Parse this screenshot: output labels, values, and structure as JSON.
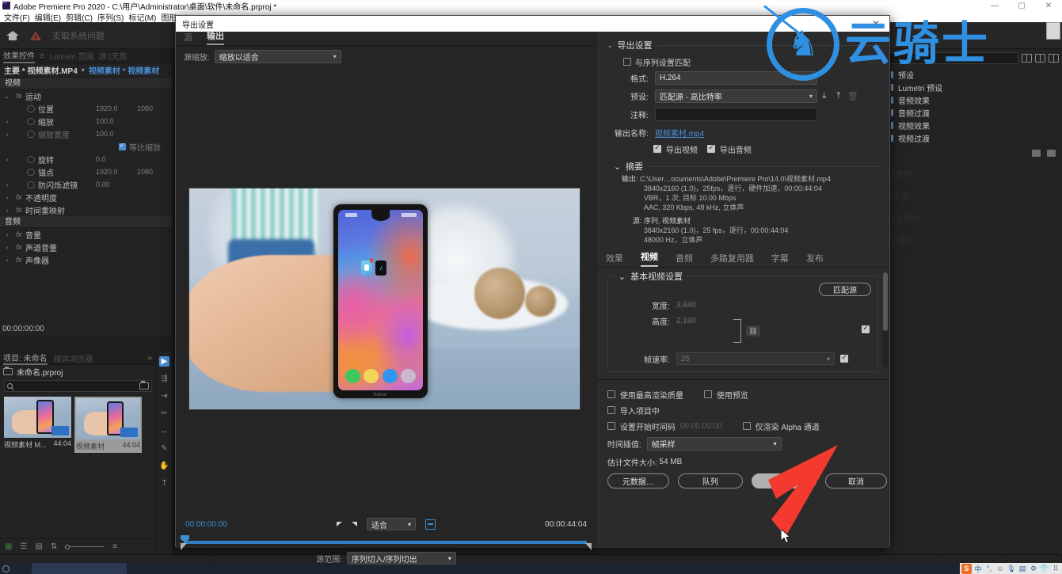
{
  "titlebar": {
    "text": "Adobe Premiere Pro 2020 - C:\\用户\\Administrator\\桌面\\软件\\未命名.prproj *",
    "minimize": "—",
    "maximize": "▢",
    "close": "✕"
  },
  "menubar": {
    "items": [
      "文件(F)",
      "编辑(E)",
      "剪辑(C)",
      "序列(S)",
      "标记(M)",
      "图形(G)"
    ]
  },
  "workspace_header": {
    "warning_text": "支取系统问题"
  },
  "effect_controls": {
    "tabs": [
      "效果控件",
      "Lumetri 范围",
      "源:(无剪"
    ],
    "active_tab": "效果控件",
    "clip_main": "主要 * 视频素材.MP4",
    "clip_sequence": "视频素材 * 视频素材",
    "sections": [
      {
        "title": "视频",
        "groups": [
          {
            "name": "运动",
            "expanded": true,
            "props": [
              {
                "name": "位置",
                "v1": "1920.0",
                "v2": "1080",
                "twirl": false
              },
              {
                "name": "缩放",
                "v1": "100.0",
                "v2": "",
                "twirl": true
              },
              {
                "name": "缩放宽度",
                "v1": "100.0",
                "v2": "",
                "twirl": true,
                "dim": true
              },
              {
                "name": "等比缩放",
                "checkbox": true
              },
              {
                "name": "旋转",
                "v1": "0.0",
                "v2": "",
                "twirl": true
              },
              {
                "name": "锚点",
                "v1": "1920.0",
                "v2": "1080",
                "twirl": false
              },
              {
                "name": "防闪烁滤镜",
                "v1": "0.00",
                "v2": "",
                "twirl": true
              }
            ]
          },
          {
            "name": "不透明度",
            "expanded": false,
            "props": []
          },
          {
            "name": "时间重映射",
            "expanded": false,
            "props": []
          }
        ]
      },
      {
        "title": "音频",
        "groups": [
          {
            "name": "音量",
            "expanded": false,
            "props": []
          },
          {
            "name": "声道音量",
            "expanded": false,
            "props": []
          },
          {
            "name": "声像器",
            "expanded": false,
            "props": []
          }
        ]
      }
    ],
    "timecode": "00:00:00:00"
  },
  "project_panel": {
    "tabs": [
      "项目: 未命名",
      "媒体浏览器"
    ],
    "active_tab": "项目: 未命名",
    "bin_name": "未命名.prproj",
    "search_placeholder": "",
    "search_value": "",
    "clips": [
      {
        "name": "视频素材 M...",
        "duration": "44:04",
        "selected": false
      },
      {
        "name": "视频素材",
        "duration": "44:04",
        "selected": true
      }
    ]
  },
  "effects_panel": {
    "items": [
      "预设",
      "Lumetri 预设",
      "音频效果",
      "音频过渡",
      "视频效果",
      "视频过渡"
    ],
    "ghost_items": [
      "<图形",
      ":声音",
      "etri 颜色",
      "记标记"
    ]
  },
  "export_dialog": {
    "title": "导出设置",
    "close_label": "✕",
    "source_tabs": [
      "源",
      "输出"
    ],
    "source_active_tab": "输出",
    "scale_label": "源缩放:",
    "scale_value": "缩放以适合",
    "playback": {
      "start_timecode": "00:00:00:00",
      "end_timecode": "00:00:44:04",
      "fit_value": "适合",
      "source_range_label": "源范围:",
      "source_range_value": "序列切入/序列切出"
    },
    "settings": {
      "group_title": "导出设置",
      "match_sequence_label": "与序列设置匹配",
      "match_sequence_checked": false,
      "format_label": "格式:",
      "format_value": "H.264",
      "preset_label": "预设:",
      "preset_value": "匹配源 - 高比特率",
      "comment_label": "注释:",
      "comment_value": "",
      "output_name_label": "输出名称:",
      "output_name_value": "视频素材.mp4",
      "export_video_label": "导出视频",
      "export_video_checked": true,
      "export_audio_label": "导出音频",
      "export_audio_checked": true
    },
    "summary": {
      "title": "摘要",
      "output_label": "输出:",
      "output_path": "C:\\User…ocuments\\Adobe\\Premiere Pro\\14.0\\视频素材.mp4",
      "output_line2": "3840x2160 (1.0)，25fps，逐行，硬件加速，00:00:44:04",
      "output_line3": "VBR，1 次, 目标 10.00 Mbps",
      "output_line4": "AAC, 320 Kbps, 48  kHz, 立体声",
      "source_label": "源:",
      "source_value": "序列, 视频素材",
      "source_line2": "3840x2160 (1.0)，25 fps，逐行，00:00:44:04",
      "source_line3": "48000 Hz，立体声"
    },
    "tabs": [
      "效果",
      "视频",
      "音频",
      "多路复用器",
      "字幕",
      "发布"
    ],
    "active_tab": "视频",
    "video_settings": {
      "group_title": "基本视频设置",
      "match_source_button": "匹配源",
      "width_label": "宽度:",
      "width_value": "3,840",
      "height_label": "高度:",
      "height_value": "2,160",
      "frame_rate_label": "帧速率:",
      "frame_rate_value": "25"
    },
    "options": {
      "max_render_label": "使用最高渲染质量",
      "max_render_checked": false,
      "use_preview_label": "使用预览",
      "use_preview_checked": false,
      "import_project_label": "导入项目中",
      "import_project_checked": false,
      "set_start_tc_label": "设置开始时间码",
      "set_start_tc_checked": false,
      "start_tc_value": "00:00:00:00",
      "alpha_only_label": "仅渲染 Alpha 通道",
      "alpha_only_checked": false,
      "time_interp_label": "时间插值:",
      "time_interp_value": "帧采样",
      "est_size_label": "估计文件大小:",
      "est_size_value": "54 MB"
    },
    "buttons": {
      "metadata": "元数据…",
      "queue": "队列",
      "export": "导出",
      "cancel": "取消"
    }
  },
  "watermark": {
    "text": "云骑士"
  },
  "taskbar": {
    "tray_icons": [
      "sogou-icon",
      "ime-chinese-icon",
      "ime-punct-icon",
      "smiley-icon",
      "mic-icon",
      "keyboard-icon",
      "toolbox-icon",
      "shirt-icon",
      "grid-icon"
    ],
    "ime_label": "中"
  }
}
